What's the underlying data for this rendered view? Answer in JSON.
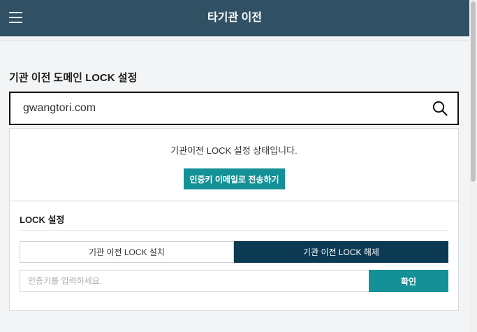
{
  "header": {
    "title": "타기관 이전",
    "menu_icon": "hamburger-menu-icon"
  },
  "domain_lock": {
    "section_title": "기관 이전 도메인 LOCK 설정",
    "domain_value": "gwangtori.com",
    "search_icon": "search-icon"
  },
  "status": {
    "message": "기관이전 LOCK 설정 상태입니다.",
    "send_button_label": "인증키 이메일로 전송하기"
  },
  "lock_settings": {
    "title": "LOCK 설정",
    "tabs": [
      {
        "label": "기관 이전 LOCK 설치",
        "selected": false
      },
      {
        "label": "기관 이전 LOCK 해제",
        "selected": true
      }
    ],
    "auth_input": {
      "value": "",
      "placeholder": "인증키를 입력하세요."
    },
    "confirm_label": "확인"
  },
  "colors": {
    "header": "#2f5163",
    "accent": "#139196",
    "selected_tab": "#0c3a52",
    "background": "#f3f4f6"
  }
}
